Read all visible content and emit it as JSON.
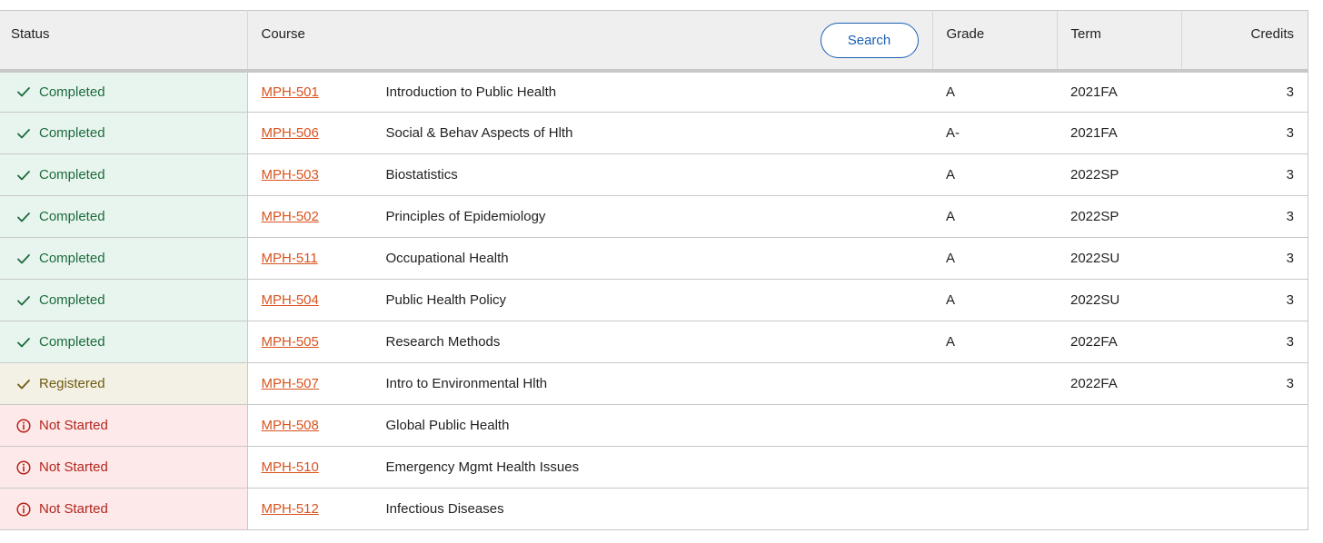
{
  "header": {
    "status": "Status",
    "course": "Course",
    "search_label": "Search",
    "grade": "Grade",
    "term": "Term",
    "credits": "Credits"
  },
  "colors": {
    "completed": "#1d6b3c",
    "registered": "#6e5a10",
    "not_started": "#b3261e",
    "course_link": "#d9531e",
    "search_accent": "#1a5fb4"
  },
  "rows": [
    {
      "status": "Completed",
      "type": "completed",
      "icon": "check-icon",
      "code": "MPH-501",
      "title": "Introduction to Public Health",
      "grade": "A",
      "term": "2021FA",
      "credits": "3"
    },
    {
      "status": "Completed",
      "type": "completed",
      "icon": "check-icon",
      "code": "MPH-506",
      "title": "Social & Behav Aspects of Hlth",
      "grade": "A-",
      "term": "2021FA",
      "credits": "3"
    },
    {
      "status": "Completed",
      "type": "completed",
      "icon": "check-icon",
      "code": "MPH-503",
      "title": "Biostatistics",
      "grade": "A",
      "term": "2022SP",
      "credits": "3"
    },
    {
      "status": "Completed",
      "type": "completed",
      "icon": "check-icon",
      "code": "MPH-502",
      "title": "Principles of Epidemiology",
      "grade": "A",
      "term": "2022SP",
      "credits": "3"
    },
    {
      "status": "Completed",
      "type": "completed",
      "icon": "check-icon",
      "code": "MPH-511",
      "title": "Occupational Health",
      "grade": "A",
      "term": "2022SU",
      "credits": "3"
    },
    {
      "status": "Completed",
      "type": "completed",
      "icon": "check-icon",
      "code": "MPH-504",
      "title": "Public Health Policy",
      "grade": "A",
      "term": "2022SU",
      "credits": "3"
    },
    {
      "status": "Completed",
      "type": "completed",
      "icon": "check-icon",
      "code": "MPH-505",
      "title": "Research Methods",
      "grade": "A",
      "term": "2022FA",
      "credits": "3"
    },
    {
      "status": "Registered",
      "type": "registered",
      "icon": "check-icon",
      "code": "MPH-507",
      "title": "Intro to Environmental Hlth",
      "grade": "",
      "term": "2022FA",
      "credits": "3"
    },
    {
      "status": "Not Started",
      "type": "notstarted",
      "icon": "info-circle-icon",
      "code": "MPH-508",
      "title": "Global Public Health",
      "grade": "",
      "term": "",
      "credits": ""
    },
    {
      "status": "Not Started",
      "type": "notstarted",
      "icon": "info-circle-icon",
      "code": "MPH-510",
      "title": "Emergency Mgmt Health Issues",
      "grade": "",
      "term": "",
      "credits": ""
    },
    {
      "status": "Not Started",
      "type": "notstarted",
      "icon": "info-circle-icon",
      "code": "MPH-512",
      "title": "Infectious Diseases",
      "grade": "",
      "term": "",
      "credits": ""
    }
  ]
}
